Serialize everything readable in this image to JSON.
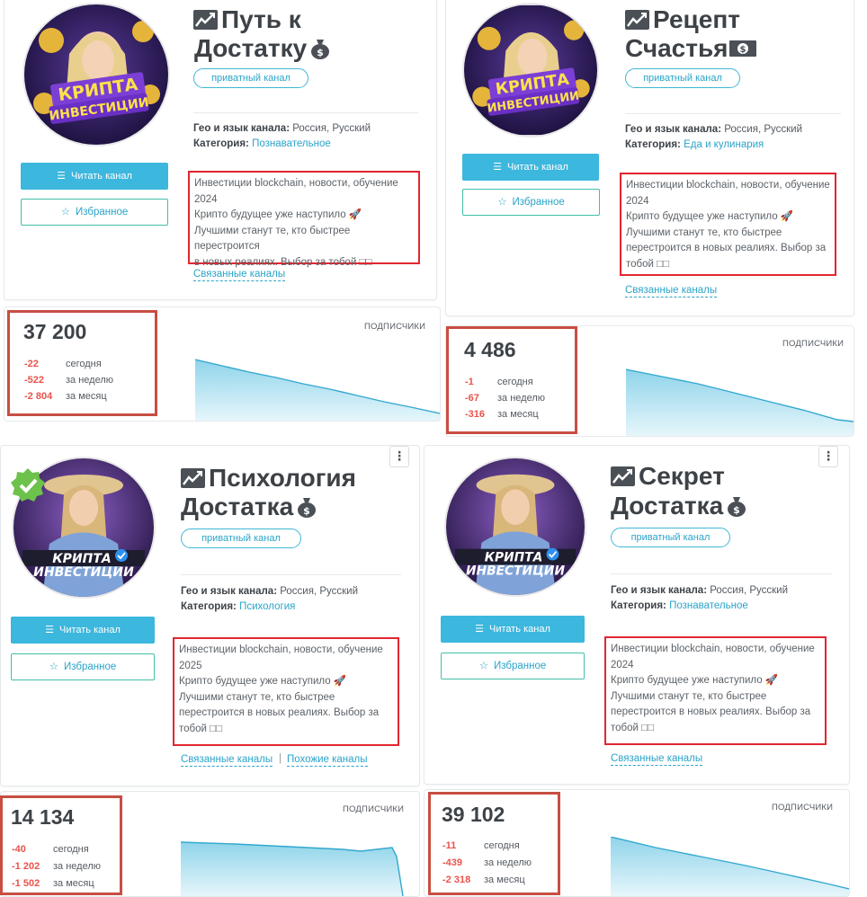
{
  "common": {
    "private_label": "приватный канал",
    "geo_label": "Гео и язык канала:",
    "geo_value": "Россия, Русский",
    "category_label": "Категория:",
    "read_button": "Читать канал",
    "fav_button": "Избранное",
    "related_label": "Связанные каналы",
    "similar_label": "Похожие каналы",
    "subscribers_label": "ПОДПИСЧИКИ",
    "today_label": "сегодня",
    "week_label": "за неделю",
    "month_label": "за месяц",
    "avatar_text_1": "КРИПТА",
    "avatar_text_2": "ИНВЕСТИЦИИ",
    "more_menu": "⋮"
  },
  "channels": [
    {
      "title_line1": "Путь к",
      "title_line2": "Достатку",
      "category": "Познавательное",
      "description": [
        "Инвестиции blockchain, новости, обучение",
        "2024",
        "Крипто будущее уже наступило 🚀",
        "Лучшими станут те, кто быстрее перестроится",
        "в новых реалиях. Выбор за тобой □□"
      ],
      "subscribers": "37 200",
      "today": "-22",
      "week": "-522",
      "month": "-2 804",
      "trend": [
        100,
        92,
        84,
        76,
        68,
        60,
        52,
        44,
        36,
        28
      ]
    },
    {
      "title_line1": "Рецепт",
      "title_line2": "Счастья",
      "category": "Еда и кулинария",
      "description": [
        "Инвестиции blockchain, новости, обучение",
        "2024",
        "Крипто будущее уже наступило 🚀",
        "Лучшими станут те, кто быстрее",
        "перестроится в новых реалиях. Выбор за",
        "тобой □□"
      ],
      "subscribers": "4 486",
      "today": "-1",
      "week": "-67",
      "month": "-316",
      "trend": [
        100,
        93,
        85,
        78,
        71,
        63,
        56,
        48,
        40,
        30
      ]
    },
    {
      "title_line1": "Психология",
      "title_line2": "Достатка",
      "category": "Психология",
      "description": [
        "Инвестиции blockchain, новости, обучение",
        "2025",
        "Крипто будущее уже наступило 🚀",
        "Лучшими станут те, кто быстрее",
        "перестроится в новых реалиях. Выбор за",
        "тобой □□"
      ],
      "subscribers": "14 134",
      "today": "-40",
      "week": "-1 202",
      "month": "-1 502",
      "trend": [
        100,
        99,
        98,
        97,
        96,
        95,
        94,
        93,
        92,
        90
      ]
    },
    {
      "title_line1": "Секрет",
      "title_line2": "Достатка",
      "category": "Познавательное",
      "description": [
        "Инвестиции blockchain, новости, обучение",
        "2024",
        "Крипто будущее уже наступило 🚀",
        "Лучшими станут те, кто быстрее",
        "перестроится в новых реалиях. Выбор за",
        "тобой □□"
      ],
      "subscribers": "39 102",
      "today": "-11",
      "week": "-439",
      "month": "-2 318",
      "trend": [
        100,
        90,
        81,
        72,
        63,
        54,
        45,
        36,
        27,
        20
      ]
    }
  ]
}
